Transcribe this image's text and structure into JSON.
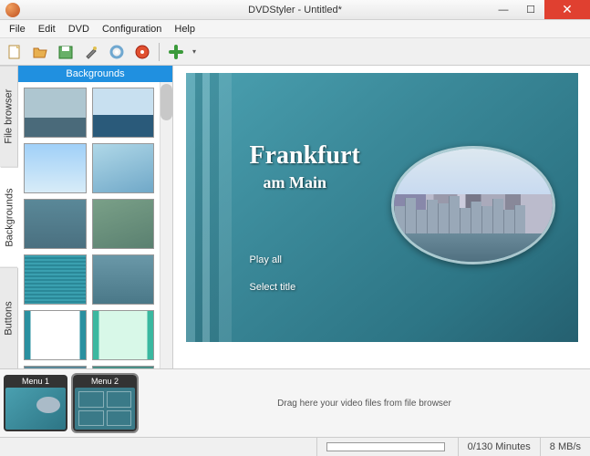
{
  "window": {
    "title": "DVDStyler - Untitled*"
  },
  "menus": {
    "file": "File",
    "edit": "Edit",
    "dvd": "DVD",
    "config": "Configuration",
    "help": "Help"
  },
  "sidetabs": {
    "file_browser": "File browser",
    "backgrounds": "Backgrounds",
    "buttons": "Buttons"
  },
  "browser": {
    "header": "Backgrounds"
  },
  "preview": {
    "title": "Frankfurt",
    "subtitle": "am Main",
    "menu_items": [
      "Play all",
      "Select title"
    ]
  },
  "timeline": {
    "menu1": "Menu 1",
    "menu2": "Menu 2",
    "hint": "Drag here your video files from file browser"
  },
  "status": {
    "duration": "0/130 Minutes",
    "rate": "8 MB/s"
  }
}
